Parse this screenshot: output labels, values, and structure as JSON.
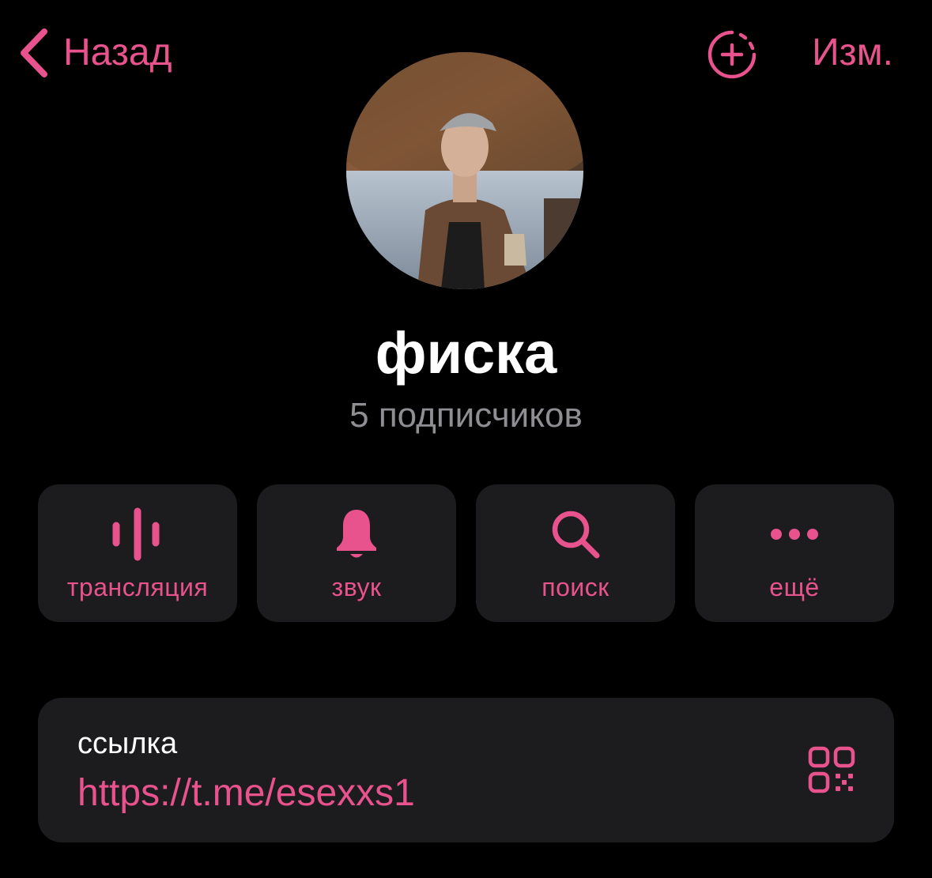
{
  "nav": {
    "back_label": "Назад",
    "edit_label": "Изм."
  },
  "profile": {
    "name": "фиска",
    "subscribers": "5 подписчиков"
  },
  "actions": [
    {
      "label": "трансляция",
      "icon": "voice-chat-icon"
    },
    {
      "label": "звук",
      "icon": "bell-icon"
    },
    {
      "label": "поиск",
      "icon": "search-icon"
    },
    {
      "label": "ещё",
      "icon": "more-dots-icon"
    }
  ],
  "link": {
    "caption": "ссылка",
    "url": "https://t.me/esexxs1",
    "icon": "qr-code-icon"
  },
  "colors": {
    "accent": "#e8528d",
    "background": "#000000",
    "card": "#1c1c1e",
    "secondary_text": "#8e8e93"
  }
}
